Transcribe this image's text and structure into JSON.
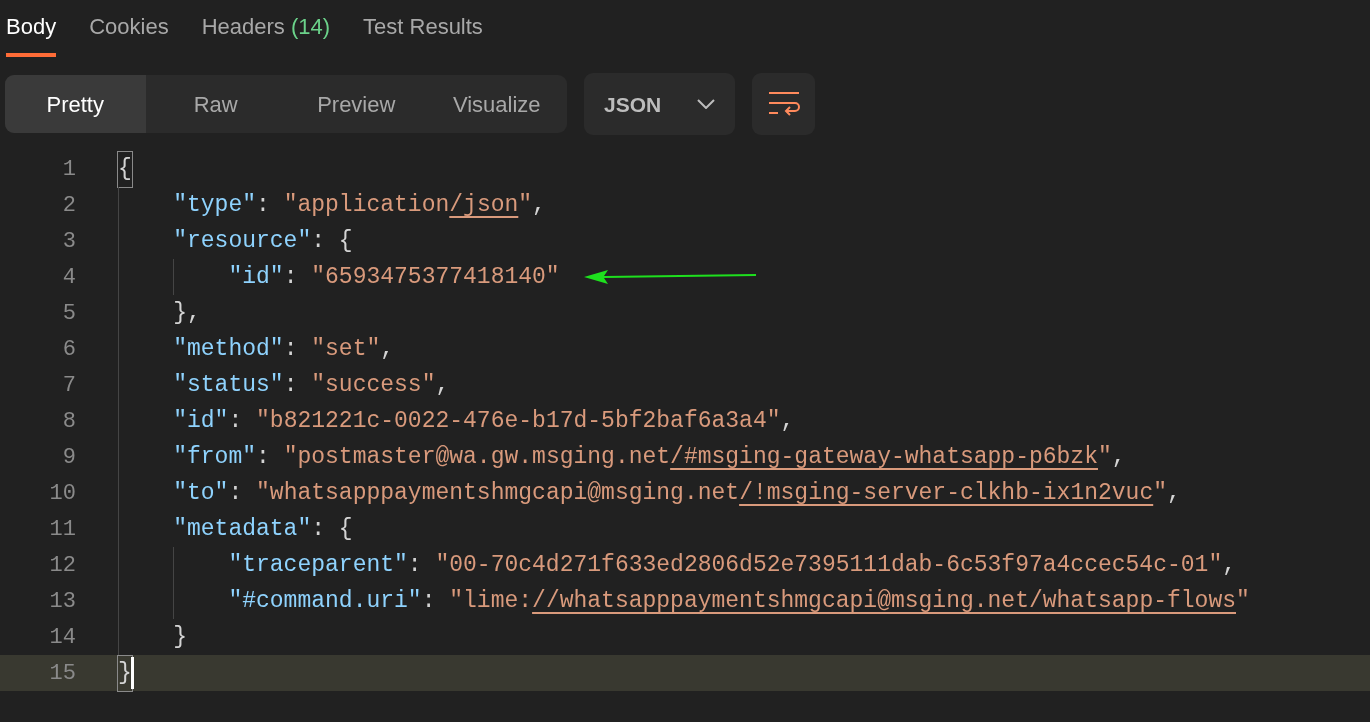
{
  "tabs": [
    {
      "label": "Body",
      "selected": true
    },
    {
      "label": "Cookies",
      "selected": false
    },
    {
      "label": "Headers",
      "count": "(14)",
      "selected": false
    },
    {
      "label": "Test Results",
      "selected": false
    }
  ],
  "view_modes": [
    {
      "label": "Pretty",
      "selected": true
    },
    {
      "label": "Raw",
      "selected": false
    },
    {
      "label": "Preview",
      "selected": false
    },
    {
      "label": "Visualize",
      "selected": false
    }
  ],
  "format_dropdown": {
    "value": "JSON"
  },
  "lines": [
    {
      "number": "1",
      "current": false,
      "tokens": [
        {
          "kind": "bracket-match",
          "text": "{"
        }
      ],
      "children": [
        {
          "number": "2",
          "current": false,
          "tokens": [
            {
              "kind": "key",
              "text": "\"type\""
            },
            {
              "kind": "punct",
              "text": ": "
            },
            {
              "kind": "string",
              "text": "\"application"
            },
            {
              "kind": "link",
              "text": "/json"
            },
            {
              "kind": "string",
              "text": "\""
            },
            {
              "kind": "punct",
              "text": ","
            }
          ]
        },
        {
          "number": "3",
          "current": false,
          "tokens": [
            {
              "kind": "key",
              "text": "\"resource\""
            },
            {
              "kind": "punct",
              "text": ": {"
            }
          ],
          "children": [
            {
              "number": "4",
              "current": false,
              "arrow": true,
              "tokens": [
                {
                  "kind": "key",
                  "text": "\"id\""
                },
                {
                  "kind": "punct",
                  "text": ": "
                },
                {
                  "kind": "string",
                  "text": "\"6593475377418140\""
                }
              ]
            }
          ]
        },
        {
          "number": "5",
          "current": false,
          "tokens": [
            {
              "kind": "punct",
              "text": "},"
            }
          ]
        },
        {
          "number": "6",
          "current": false,
          "tokens": [
            {
              "kind": "key",
              "text": "\"method\""
            },
            {
              "kind": "punct",
              "text": ": "
            },
            {
              "kind": "string",
              "text": "\"set\""
            },
            {
              "kind": "punct",
              "text": ","
            }
          ]
        },
        {
          "number": "7",
          "current": false,
          "tokens": [
            {
              "kind": "key",
              "text": "\"status\""
            },
            {
              "kind": "punct",
              "text": ": "
            },
            {
              "kind": "string",
              "text": "\"success\""
            },
            {
              "kind": "punct",
              "text": ","
            }
          ]
        },
        {
          "number": "8",
          "current": false,
          "tokens": [
            {
              "kind": "key",
              "text": "\"id\""
            },
            {
              "kind": "punct",
              "text": ": "
            },
            {
              "kind": "string",
              "text": "\"b821221c-0022-476e-b17d-5bf2baf6a3a4\""
            },
            {
              "kind": "punct",
              "text": ","
            }
          ]
        },
        {
          "number": "9",
          "current": false,
          "tokens": [
            {
              "kind": "key",
              "text": "\"from\""
            },
            {
              "kind": "punct",
              "text": ": "
            },
            {
              "kind": "string",
              "text": "\"postmaster@wa.gw.msging.net"
            },
            {
              "kind": "link",
              "text": "/#msging-gateway-whatsapp-p6bzk"
            },
            {
              "kind": "string",
              "text": "\""
            },
            {
              "kind": "punct",
              "text": ","
            }
          ]
        },
        {
          "number": "10",
          "current": false,
          "tokens": [
            {
              "kind": "key",
              "text": "\"to\""
            },
            {
              "kind": "punct",
              "text": ": "
            },
            {
              "kind": "string",
              "text": "\"whatsapppaymentshmgcapi@msging.net"
            },
            {
              "kind": "link",
              "text": "/!msging-server-clkhb-ix1n2vuc"
            },
            {
              "kind": "string",
              "text": "\""
            },
            {
              "kind": "punct",
              "text": ","
            }
          ]
        },
        {
          "number": "11",
          "current": false,
          "tokens": [
            {
              "kind": "key",
              "text": "\"metadata\""
            },
            {
              "kind": "punct",
              "text": ": {"
            }
          ],
          "children": [
            {
              "number": "12",
              "current": false,
              "tokens": [
                {
                  "kind": "key",
                  "text": "\"traceparent\""
                },
                {
                  "kind": "punct",
                  "text": ": "
                },
                {
                  "kind": "string",
                  "text": "\"00-70c4d271f633ed2806d52e7395111dab-6c53f97a4ccec54c-01\""
                },
                {
                  "kind": "punct",
                  "text": ","
                }
              ]
            },
            {
              "number": "13",
              "current": false,
              "tokens": [
                {
                  "kind": "key",
                  "text": "\"#command.uri\""
                },
                {
                  "kind": "punct",
                  "text": ": "
                },
                {
                  "kind": "string",
                  "text": "\"lime:"
                },
                {
                  "kind": "link",
                  "text": "//whatsapppaymentshmgcapi@msging.net/whatsapp-flows"
                },
                {
                  "kind": "string",
                  "text": "\""
                }
              ]
            }
          ]
        },
        {
          "number": "14",
          "current": false,
          "tokens": [
            {
              "kind": "punct",
              "text": "}"
            }
          ]
        }
      ]
    },
    {
      "number": "15",
      "current": true,
      "tokens": [
        {
          "kind": "bracket-match",
          "text": "}"
        }
      ]
    }
  ]
}
